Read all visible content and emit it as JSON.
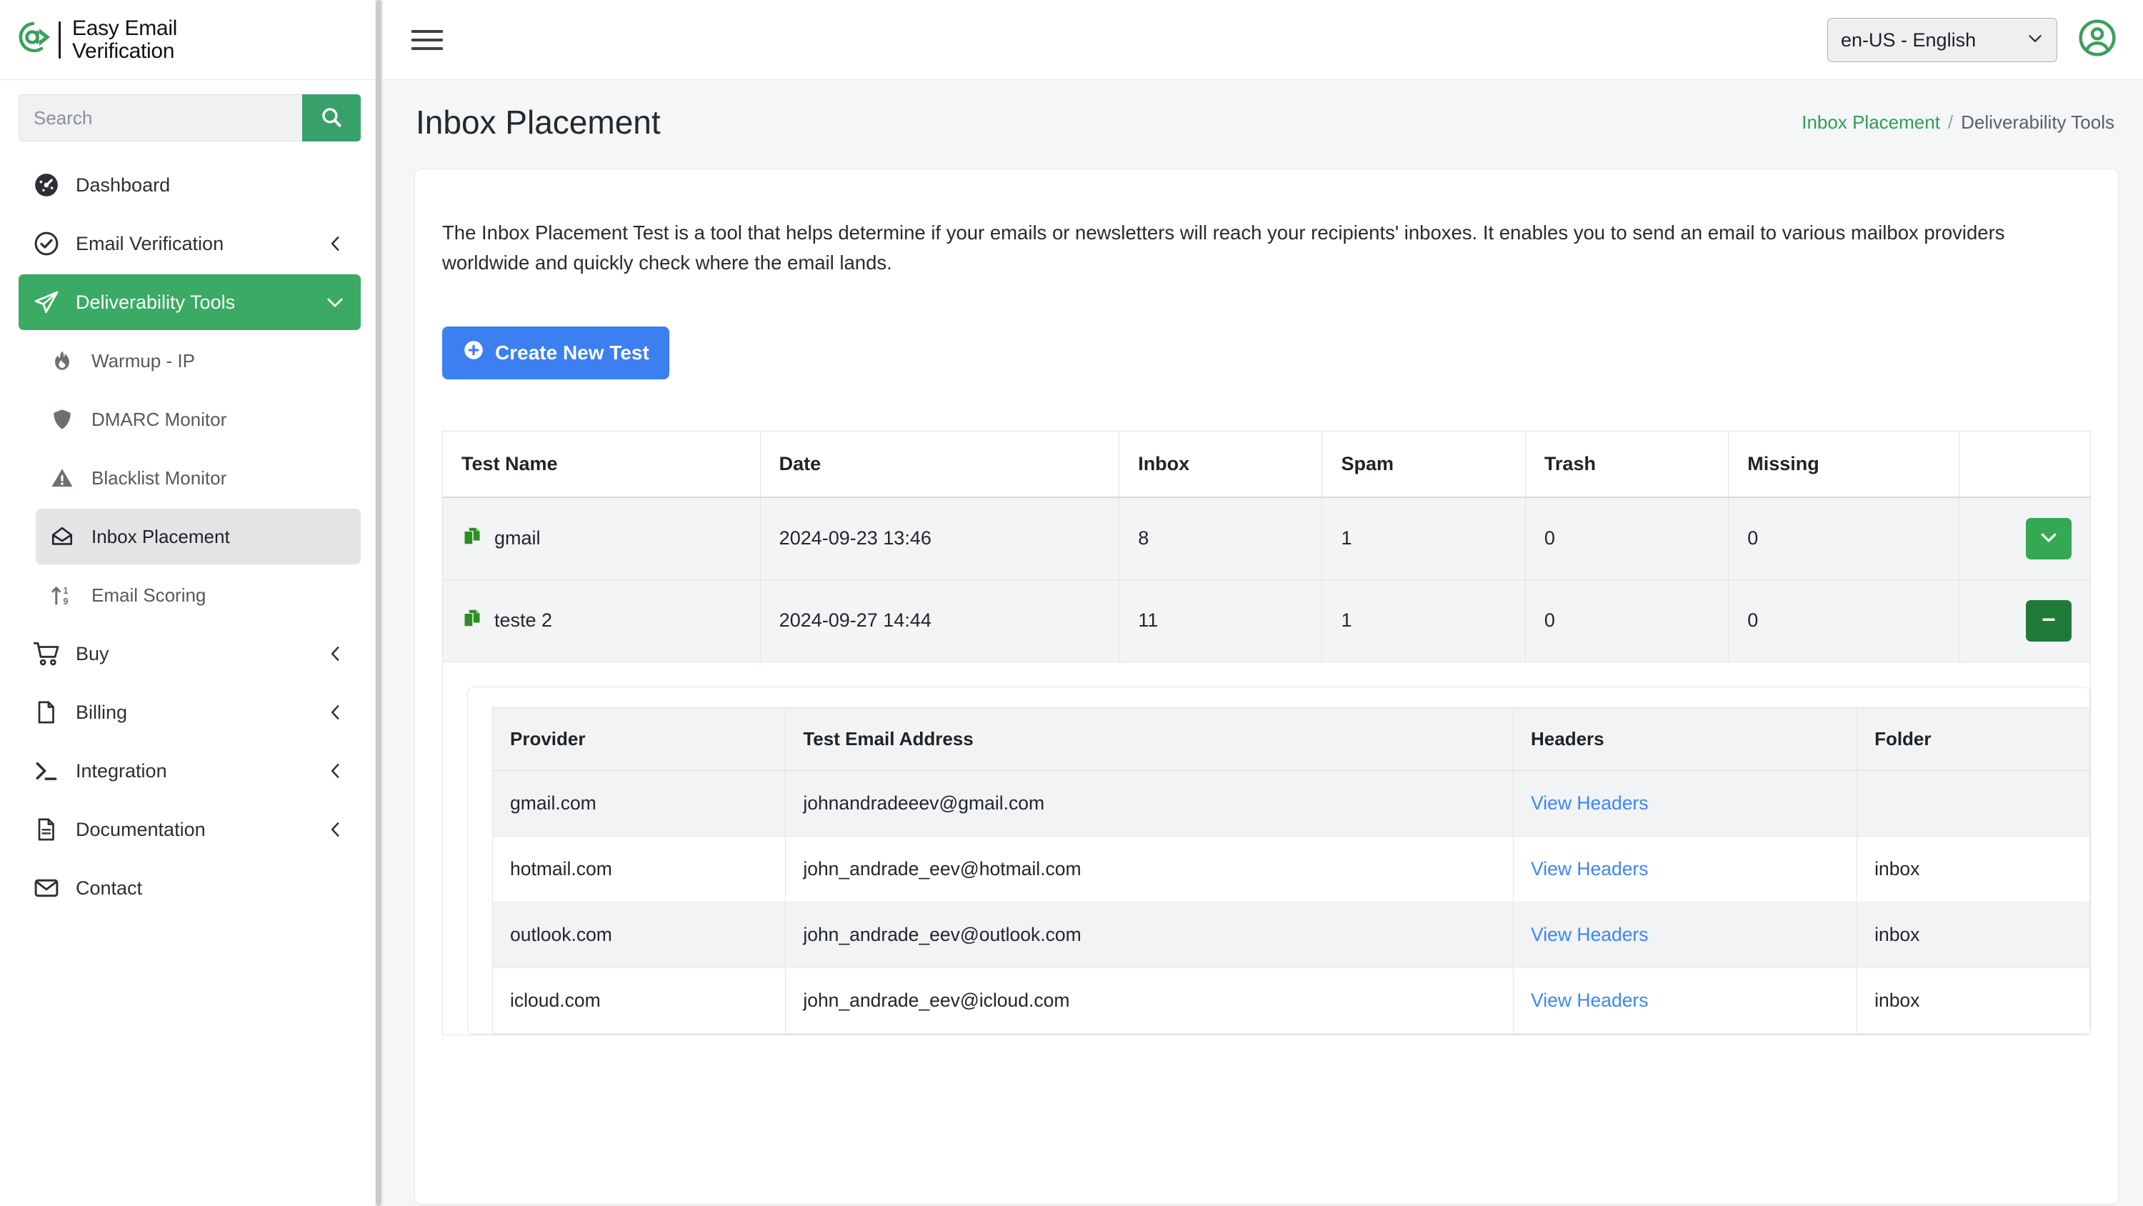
{
  "brand": {
    "line1": "Easy Email",
    "line2": "Verification",
    "at_icon": "at-arrow-logo"
  },
  "search": {
    "placeholder": "Search",
    "value": "",
    "button_icon": "search-icon"
  },
  "sidebar": {
    "items": [
      {
        "label": "Dashboard",
        "icon": "dashboard-gauge-icon",
        "caret": "",
        "state": "default",
        "level": "top"
      },
      {
        "label": "Email Verification",
        "icon": "check-circle-icon",
        "caret": "chevron-left-icon",
        "state": "default",
        "level": "top"
      },
      {
        "label": "Deliverability Tools",
        "icon": "paper-plane-icon",
        "caret": "chevron-down-icon",
        "state": "active",
        "level": "top"
      },
      {
        "label": "Warmup - IP",
        "icon": "flame-icon",
        "caret": "",
        "state": "default",
        "level": "sub"
      },
      {
        "label": "DMARC Monitor",
        "icon": "shield-icon",
        "caret": "",
        "state": "default",
        "level": "sub"
      },
      {
        "label": "Blacklist Monitor",
        "icon": "warning-triangle-icon",
        "caret": "",
        "state": "default",
        "level": "sub"
      },
      {
        "label": "Inbox Placement",
        "icon": "open-envelope-icon",
        "caret": "",
        "state": "selected",
        "level": "sub"
      },
      {
        "label": "Email Scoring",
        "icon": "sort-numeric-up-icon",
        "caret": "",
        "state": "default",
        "level": "sub"
      },
      {
        "label": "Buy",
        "icon": "shopping-cart-icon",
        "caret": "chevron-left-icon",
        "state": "default",
        "level": "top"
      },
      {
        "label": "Billing",
        "icon": "file-icon",
        "caret": "chevron-left-icon",
        "state": "default",
        "level": "top"
      },
      {
        "label": "Integration",
        "icon": "terminal-prompt-icon",
        "caret": "chevron-left-icon",
        "state": "default",
        "level": "top"
      },
      {
        "label": "Documentation",
        "icon": "document-lines-icon",
        "caret": "chevron-left-icon",
        "state": "default",
        "level": "top"
      },
      {
        "label": "Contact",
        "icon": "envelope-icon",
        "caret": "",
        "state": "default",
        "level": "top"
      }
    ]
  },
  "topbar": {
    "menu_toggle_icon": "hamburger-icon",
    "language": {
      "selected": "en-US - English",
      "options": [
        "en-US - English"
      ],
      "caret_icon": "chevron-down-icon"
    },
    "account_icon": "user-circle-icon"
  },
  "page": {
    "title": "Inbox Placement",
    "breadcrumb": {
      "current": "Inbox Placement",
      "separator": "/",
      "parent": "Deliverability Tools"
    }
  },
  "main": {
    "intro": "The Inbox Placement Test is a tool that helps determine if your emails or newsletters will reach your recipients' inboxes. It enables you to send an email to various mailbox providers worldwide and quickly check where the email lands.",
    "create_button": {
      "label": "Create New Test",
      "icon": "plus-circle-icon"
    }
  },
  "tests_table": {
    "headers": [
      "Test Name",
      "Date",
      "Inbox",
      "Spam",
      "Trash",
      "Missing",
      ""
    ],
    "rows": [
      {
        "name": "gmail",
        "name_icon": "copy-icon",
        "date": "2024-09-23 13:46",
        "inbox": "8",
        "spam": "1",
        "trash": "0",
        "missing": "0",
        "action_icon": "chevron-down-icon",
        "action_state": "expand"
      },
      {
        "name": "teste 2",
        "name_icon": "copy-icon",
        "date": "2024-09-27 14:44",
        "inbox": "11",
        "spam": "1",
        "trash": "0",
        "missing": "0",
        "action_icon": "minus-icon",
        "action_state": "collapse"
      }
    ]
  },
  "detail_table": {
    "headers": [
      "Provider",
      "Test Email Address",
      "Headers",
      "Folder"
    ],
    "rows": [
      {
        "provider": "gmail.com",
        "email": "johnandradeeev@gmail.com",
        "headers_link": "View Headers",
        "folder": ""
      },
      {
        "provider": "hotmail.com",
        "email": "john_andrade_eev@hotmail.com",
        "headers_link": "View Headers",
        "folder": "inbox"
      },
      {
        "provider": "outlook.com",
        "email": "john_andrade_eev@outlook.com",
        "headers_link": "View Headers",
        "folder": "inbox"
      },
      {
        "provider": "icloud.com",
        "email": "john_andrade_eev@icloud.com",
        "headers_link": "View Headers",
        "folder": "inbox"
      }
    ]
  },
  "colors": {
    "brand_green": "#3aaa64",
    "accent_blue": "#3b7ff0",
    "link_blue": "#3b87f7",
    "expand_green": "#34a853",
    "collapse_green": "#1f7a38",
    "breadcrumb_green": "#2f9e56"
  }
}
